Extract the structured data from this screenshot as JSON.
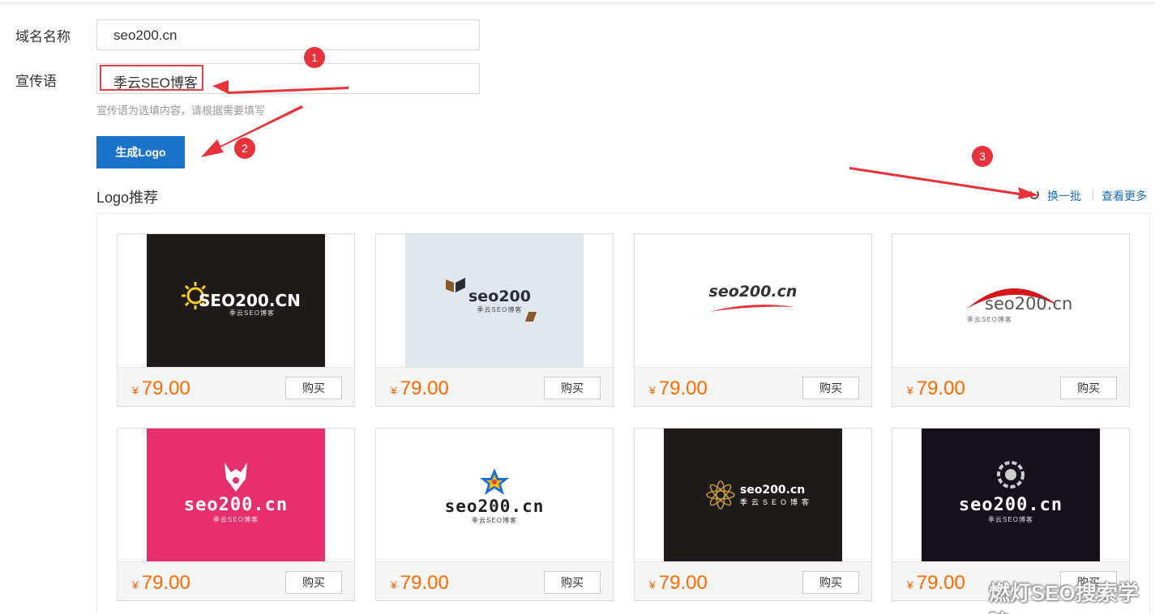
{
  "form": {
    "domain_label": "域名名称",
    "domain_value": "seo200.cn",
    "slogan_label": "宣传语",
    "slogan_value": "季云SEO博客",
    "slogan_hint": "宣传语为选填内容，请根据需要填写",
    "generate_button": "生成Logo"
  },
  "recommend": {
    "title": "Logo推荐",
    "refresh_label": "换一批",
    "more_label": "查看更多"
  },
  "currency": "¥",
  "buy_label": "购买",
  "logos": [
    {
      "text": "SEO200.CN",
      "subtitle": "季云SEO博客",
      "price": "79.00",
      "bg": "#1f1b1a",
      "fg": "#ffffff",
      "accent": "#f5d020",
      "icon": "sun-icon"
    },
    {
      "text": "seo200",
      "subtitle": "季云SEO博客",
      "price": "79.00",
      "bg": "#dfe8ec",
      "fg": "#2b2b3a",
      "accent": "#8a5a2b",
      "icon": "cube-pieces-icon"
    },
    {
      "text": "seo200.cn",
      "subtitle": "",
      "price": "79.00",
      "bg": "#ffffff",
      "fg": "#333333",
      "accent": "#e8333a",
      "icon": "swoosh-icon"
    },
    {
      "text": "seo200.cn",
      "subtitle": "季云SEO博客",
      "price": "79.00",
      "bg": "#ffffff",
      "fg": "#555555",
      "accent": "#d8151b",
      "icon": "arc-icon"
    },
    {
      "text": "seo200.cn",
      "subtitle": "季云SEO博客",
      "price": "79.00",
      "bg": "#e82f6e",
      "fg": "#ffffff",
      "accent": "#ffffff",
      "icon": "wolf-icon"
    },
    {
      "text": "seo200.cn",
      "subtitle": "季云SEO博客",
      "price": "79.00",
      "bg": "#ffffff",
      "fg": "#222222",
      "accent": "#e83a3a",
      "icon": "star-icon"
    },
    {
      "text": "seo200.cn",
      "subtitle": "季云SEO博客",
      "price": "79.00",
      "bg": "#1f1b1a",
      "fg": "#ffffff",
      "accent": "#c49a3c",
      "icon": "flower-icon"
    },
    {
      "text": "seo200.cn",
      "subtitle": "季云SEO博客",
      "price": "79.00",
      "bg": "#15101a",
      "fg": "#ffffff",
      "accent": "#cccccc",
      "icon": "lion-icon"
    }
  ],
  "annotations": [
    "1",
    "2",
    "3"
  ],
  "annotation_color": "#e8333a",
  "watermark": "燃灯SEO搜索学院"
}
